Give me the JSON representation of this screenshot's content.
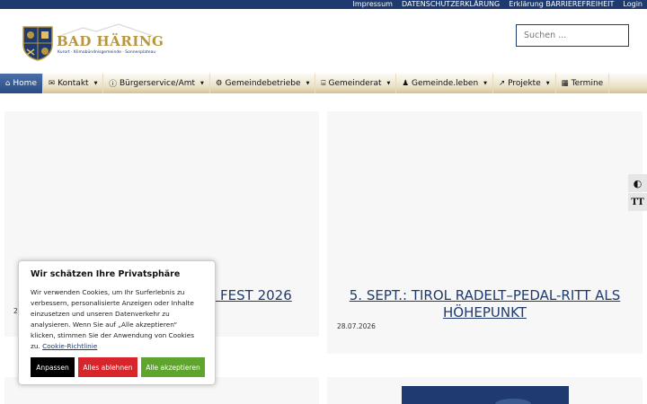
{
  "topbar": {
    "links": [
      "Impressum",
      "DATENSCHUTZERKLÄRUNG",
      "Erklärung BARRIEREFREIHEIT",
      "Login"
    ]
  },
  "logo": {
    "name": "BAD HÄRING",
    "tagline": "Kurort · Klimabündnisgemeinde · Sonnenplateau"
  },
  "search": {
    "placeholder": "Suchen ..."
  },
  "nav": [
    {
      "label": "Home",
      "icon": "home-icon",
      "active": true
    },
    {
      "label": "Kontakt",
      "icon": "mail-icon"
    },
    {
      "label": "Bürgerservice/Amt",
      "icon": "info-icon"
    },
    {
      "label": "Gemeindebetriebe",
      "icon": "cog-icon"
    },
    {
      "label": "Gemeinderat",
      "icon": "building-icon"
    },
    {
      "label": "Gemeinde.leben",
      "icon": "person-icon"
    },
    {
      "label": "Projekte",
      "icon": "trend-icon"
    },
    {
      "label": "Termine",
      "icon": "calendar-icon"
    }
  ],
  "posts": [
    {
      "title_fragment": "A FEST 2026",
      "date_fragment": "2"
    },
    {
      "title": "5. SEPT.: TIROL RADELT–PEDAL-RITT ALS HÖHEPUNKT",
      "date": "28.07.2026"
    }
  ],
  "cookie": {
    "title": "Wir schätzen Ihre Privatsphäre",
    "text": "Wir verwenden Cookies, um Ihr Surferlebnis zu verbessern, personalisierte Anzeigen oder Inhalte einzusetzen und unseren Datenverkehr zu analysieren. Wenn Sie auf „Alle akzeptieren“ klicken, stimmen Sie der Anwendung von Cookies zu.",
    "link": "Cookie-Richtlinie",
    "customize": "Anpassen",
    "reject": "Alles ablehnen",
    "accept": "Alle akzeptieren"
  },
  "colors": {
    "brand_blue": "#1f3a6e",
    "brand_gold": "#b8963e",
    "reject": "#d6262c",
    "accept": "#5fa52d"
  }
}
